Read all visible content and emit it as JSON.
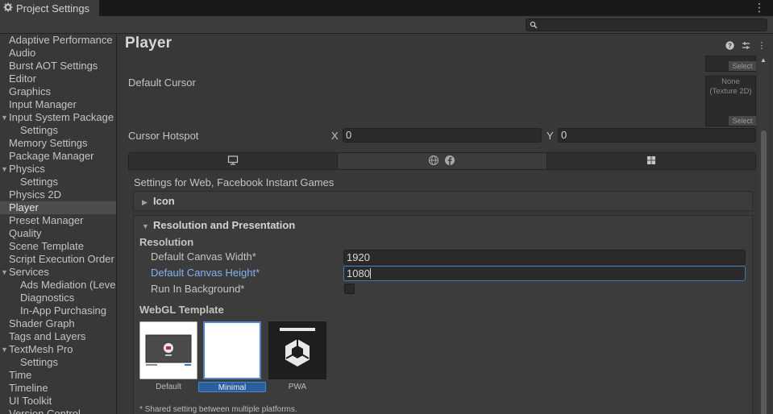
{
  "window": {
    "tab_title": "Project Settings",
    "tab_icon": "gear-icon",
    "menu_icon": "kebab-menu-icon"
  },
  "search": {
    "placeholder": "",
    "icon": "search-icon"
  },
  "sidebar": {
    "items": [
      {
        "label": "Adaptive Performance",
        "level": 0,
        "expandable": false,
        "selected": false
      },
      {
        "label": "Audio",
        "level": 0,
        "expandable": false,
        "selected": false
      },
      {
        "label": "Burst AOT Settings",
        "level": 0,
        "expandable": false,
        "selected": false
      },
      {
        "label": "Editor",
        "level": 0,
        "expandable": false,
        "selected": false
      },
      {
        "label": "Graphics",
        "level": 0,
        "expandable": false,
        "selected": false
      },
      {
        "label": "Input Manager",
        "level": 0,
        "expandable": false,
        "selected": false
      },
      {
        "label": "Input System Package",
        "level": 0,
        "expandable": true,
        "selected": false
      },
      {
        "label": "Settings",
        "level": 1,
        "expandable": false,
        "selected": false
      },
      {
        "label": "Memory Settings",
        "level": 0,
        "expandable": false,
        "selected": false
      },
      {
        "label": "Package Manager",
        "level": 0,
        "expandable": false,
        "selected": false
      },
      {
        "label": "Physics",
        "level": 0,
        "expandable": true,
        "selected": false
      },
      {
        "label": "Settings",
        "level": 1,
        "expandable": false,
        "selected": false
      },
      {
        "label": "Physics 2D",
        "level": 0,
        "expandable": false,
        "selected": false
      },
      {
        "label": "Player",
        "level": 0,
        "expandable": false,
        "selected": true
      },
      {
        "label": "Preset Manager",
        "level": 0,
        "expandable": false,
        "selected": false
      },
      {
        "label": "Quality",
        "level": 0,
        "expandable": false,
        "selected": false
      },
      {
        "label": "Scene Template",
        "level": 0,
        "expandable": false,
        "selected": false
      },
      {
        "label": "Script Execution Order",
        "level": 0,
        "expandable": false,
        "selected": false
      },
      {
        "label": "Services",
        "level": 0,
        "expandable": true,
        "selected": false
      },
      {
        "label": "Ads Mediation (Level",
        "level": 1,
        "expandable": false,
        "selected": false
      },
      {
        "label": "Diagnostics",
        "level": 1,
        "expandable": false,
        "selected": false
      },
      {
        "label": "In-App Purchasing",
        "level": 1,
        "expandable": false,
        "selected": false
      },
      {
        "label": "Shader Graph",
        "level": 0,
        "expandable": false,
        "selected": false
      },
      {
        "label": "Tags and Layers",
        "level": 0,
        "expandable": false,
        "selected": false
      },
      {
        "label": "TextMesh Pro",
        "level": 0,
        "expandable": true,
        "selected": false
      },
      {
        "label": "Settings",
        "level": 1,
        "expandable": false,
        "selected": false
      },
      {
        "label": "Time",
        "level": 0,
        "expandable": false,
        "selected": false
      },
      {
        "label": "Timeline",
        "level": 0,
        "expandable": false,
        "selected": false
      },
      {
        "label": "UI Toolkit",
        "level": 0,
        "expandable": false,
        "selected": false
      },
      {
        "label": "Version Control",
        "level": 0,
        "expandable": false,
        "selected": false
      }
    ]
  },
  "main": {
    "title": "Player",
    "header_icons": [
      "help-icon",
      "preset-icon",
      "kebab-menu-icon"
    ],
    "texture_select_label": "Select",
    "default_cursor": {
      "label": "Default Cursor",
      "slot_text_line1": "None",
      "slot_text_line2": "(Texture 2D)",
      "select_label": "Select"
    },
    "cursor_hotspot": {
      "label": "Cursor Hotspot",
      "x_label": "X",
      "x_value": "0",
      "y_label": "Y",
      "y_value": "0"
    },
    "platform_tabs": [
      {
        "icons": [
          "monitor-icon"
        ],
        "active": false
      },
      {
        "icons": [
          "globe-icon",
          "facebook-icon"
        ],
        "active": true
      },
      {
        "icons": [
          "windows-icon"
        ],
        "active": false
      }
    ],
    "settings_for": "Settings for Web, Facebook Instant Games",
    "icon_foldout": {
      "label": "Icon",
      "expanded": false
    },
    "resolution_foldout": {
      "label": "Resolution and Presentation",
      "expanded": true,
      "resolution_header": "Resolution",
      "canvas_width_label": "Default Canvas Width*",
      "canvas_width_value": "1920",
      "canvas_height_label": "Default Canvas Height*",
      "canvas_height_value": "1080",
      "run_in_background_label": "Run In Background*",
      "run_in_background_checked": false,
      "webgl_template_header": "WebGL Template",
      "templates": [
        {
          "label": "Default",
          "selected": false
        },
        {
          "label": "Minimal",
          "selected": true
        },
        {
          "label": "PWA",
          "selected": false
        }
      ],
      "footnote": "* Shared setting between multiple platforms."
    }
  },
  "colors": {
    "background": "#383838",
    "titlebar": "#191919",
    "selected_item": "#4d4d4d",
    "focus_blue": "#3a79bb",
    "focused_label": "#7fb4f0",
    "template_selected": "#2c5d9c"
  }
}
